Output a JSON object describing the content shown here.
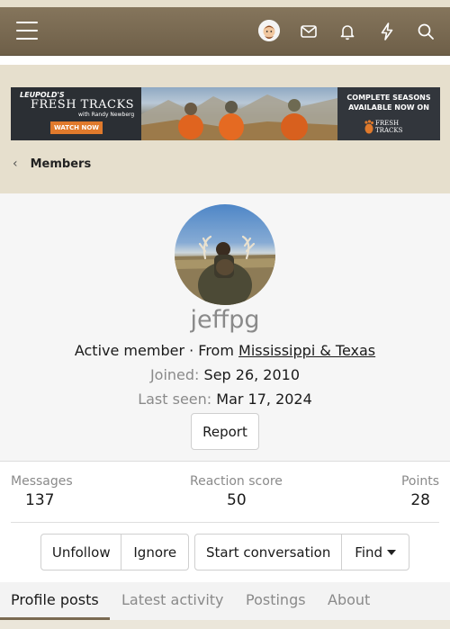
{
  "header": {
    "icons": [
      "menu-icon",
      "user-avatar",
      "envelope-icon",
      "bell-icon",
      "lightning-icon",
      "search-icon"
    ]
  },
  "banner": {
    "brand_small": "LEUPOLD'S",
    "brand_title": "FRESH TRACKS",
    "brand_sub": "with Randy Newberg",
    "cta": "WATCH NOW",
    "promo_line1": "COMPLETE SEASONS",
    "promo_line2": "AVAILABLE NOW ON",
    "logo_text": "FRESH TRACKS"
  },
  "breadcrumb": {
    "label": "Members"
  },
  "profile": {
    "username": "jeffpg",
    "title": "Active member",
    "from_prefix": "· From",
    "location": "Mississippi & Texas",
    "joined_label": "Joined:",
    "joined_value": "Sep 26, 2010",
    "last_seen_label": "Last seen:",
    "last_seen_value": "Mar 17, 2024",
    "report_label": "Report"
  },
  "stats": {
    "messages_label": "Messages",
    "messages_value": "137",
    "reaction_label": "Reaction score",
    "reaction_value": "50",
    "points_label": "Points",
    "points_value": "28"
  },
  "actions": {
    "unfollow": "Unfollow",
    "ignore": "Ignore",
    "start_conversation": "Start conversation",
    "find": "Find"
  },
  "tabs": [
    "Profile posts",
    "Latest activity",
    "Postings",
    "About"
  ],
  "colors": {
    "header": "#7a6a52",
    "accent": "#7a6a52",
    "banner_cta": "#e07a2c"
  }
}
